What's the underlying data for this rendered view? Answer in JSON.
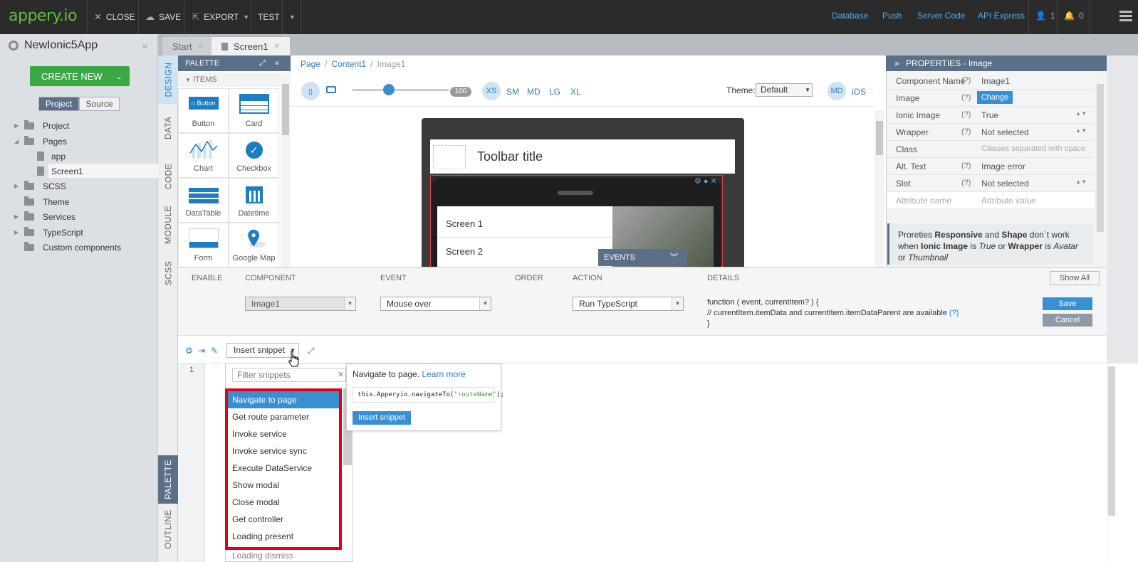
{
  "topbar": {
    "logo": "appery.io",
    "close": "CLOSE",
    "save": "SAVE",
    "export": "EXPORT",
    "test": "TEST",
    "links": [
      "Database",
      "Push",
      "Server Code",
      "API Express"
    ],
    "user_count": "1",
    "notif_count": "0"
  },
  "sidebar": {
    "app_name": "NewIonic5App",
    "create_new": "CREATE NEW",
    "tabs": [
      "Project",
      "Source"
    ],
    "tree": [
      "Project",
      "Pages",
      "app",
      "Screen1",
      "SCSS",
      "Theme",
      "Services",
      "TypeScript",
      "Custom components"
    ]
  },
  "vtabs": [
    "DESIGN",
    "DATA",
    "CODE",
    "MODULE",
    "SCSS",
    "PALETTE",
    "OUTLINE"
  ],
  "doctabs": [
    "Start",
    "Screen1"
  ],
  "palette": {
    "title": "PALETTE",
    "section": "ITEMS",
    "items": [
      "Button",
      "Card",
      "Chart",
      "Checkbox",
      "DataTable",
      "Datetime",
      "Form",
      "Google Map"
    ],
    "button_icon_label": "Button"
  },
  "canvas": {
    "breadcrumb": [
      "Page",
      "Content1",
      "Image1"
    ],
    "zoom": "100",
    "breakpoints": [
      "XS",
      "SM",
      "MD",
      "LG",
      "XL"
    ],
    "theme_label": "Theme:",
    "theme_value": "Default",
    "mode_badge": "MD",
    "platform": "iOS",
    "toolbar_title": "Toolbar title",
    "menu_items": [
      "Screen 1",
      "Screen 2"
    ],
    "events_label": "EVENTS"
  },
  "properties": {
    "title": "PROPERTIES - Image",
    "rows": [
      {
        "key": "Component Name",
        "help": "(?)",
        "value": "Image1"
      },
      {
        "key": "Image",
        "help": "(?)",
        "value": "Change"
      },
      {
        "key": "Ionic Image",
        "help": "(?)",
        "value": "True"
      },
      {
        "key": "Wrapper",
        "help": "(?)",
        "value": "Not selected"
      },
      {
        "key": "Class",
        "help": "",
        "value": "Classes separated with space"
      },
      {
        "key": "Alt. Text",
        "help": "(?)",
        "value": "Image error"
      },
      {
        "key": "Slot",
        "help": "(?)",
        "value": "Not selected"
      },
      {
        "key": "Attribute name",
        "help": "",
        "value": "Attribute value"
      }
    ],
    "note": {
      "t1": "Proreties ",
      "b1": "Responsive",
      "t2": " and ",
      "b2": "Shape",
      "t3": " don`t work when ",
      "b3": "Ionic Image",
      "t4": " is ",
      "i1": "True",
      "t5": " or ",
      "b4": "Wrapper",
      "t6": " is ",
      "i2": "Avatar",
      "t7": " or ",
      "i3": "Thumbnail"
    }
  },
  "events": {
    "headers": [
      "ENABLE",
      "COMPONENT",
      "EVENT",
      "ORDER",
      "ACTION",
      "DETAILS"
    ],
    "show_all": "Show All",
    "component": "Image1",
    "event": "Mouse over",
    "action": "Run TypeScript",
    "details_line1": "function ( event, currentItem? ) {",
    "details_line2": "// currentItem.itemData and currentItem.itemDataParent are available",
    "details_help": "(?)",
    "details_line3": "}",
    "save": "Save",
    "cancel": "Cancel"
  },
  "editor": {
    "insert_snippet": "Insert snippet",
    "line_number": "1",
    "filter_placeholder": "Filter snippets",
    "snippets": [
      "Navigate to page",
      "Get route parameter",
      "Invoke service",
      "Invoke service sync",
      "Execute DataService",
      "Show modal",
      "Close modal",
      "Get controller",
      "Loading present"
    ],
    "more_snippet": "Loading dismiss",
    "preview_title": "Navigate to page.",
    "preview_link": "Learn more",
    "preview_code_pre": "this.Apperyio.navigateTo(",
    "preview_code_str": "\"routeName\"",
    "preview_code_post": ");",
    "preview_insert": "Insert snippet"
  }
}
